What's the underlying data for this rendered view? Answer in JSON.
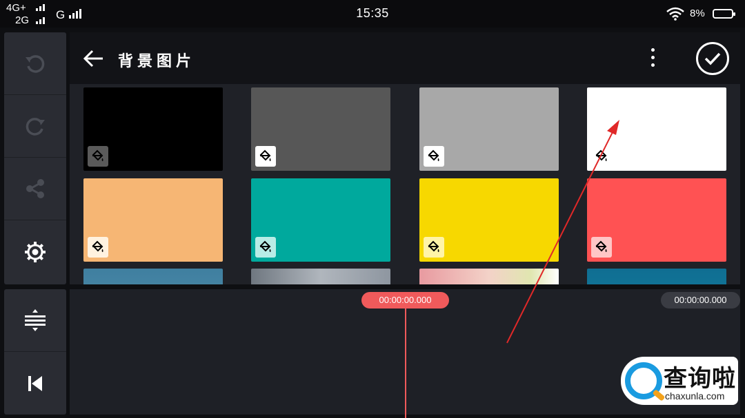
{
  "status_bar": {
    "network_1": "4G+",
    "network_2": "2G",
    "network_3": "G",
    "time": "15:35",
    "battery": "8%"
  },
  "toolbar": {
    "icons": [
      "undo-icon",
      "redo-icon",
      "share-icon",
      "settings-gear-icon"
    ],
    "bottom_icons": [
      "timeline-expand-icon",
      "skip-to-start-icon"
    ]
  },
  "header": {
    "title": "背景图片",
    "back_icon": "arrow-left-icon",
    "more_icon": "more-vertical-icon",
    "confirm_icon": "checkmark-circle-icon"
  },
  "backgrounds": [
    {
      "color": "#000000",
      "type": "solid"
    },
    {
      "color": "#575757",
      "type": "solid"
    },
    {
      "color": "#a8a8a8",
      "type": "solid"
    },
    {
      "color": "#ffffff",
      "type": "solid"
    },
    {
      "color": "#f6b674",
      "type": "solid"
    },
    {
      "color": "#00a99d",
      "type": "solid"
    },
    {
      "color": "#f7d800",
      "type": "solid"
    },
    {
      "color": "#ff5253",
      "type": "solid"
    },
    {
      "color": "#3f7fa0",
      "type": "image"
    },
    {
      "color": "#8e96a0",
      "type": "image"
    },
    {
      "color": "#d9a3a3",
      "type": "image"
    },
    {
      "color": "#147a9c",
      "type": "image"
    }
  ],
  "timeline": {
    "current_time": "00:00:00.000",
    "total_time": "00:00:00.000",
    "accent_color": "#f05a5b"
  },
  "watermark": {
    "text_cn": "查询啦",
    "text_en": "chaxunla.com"
  }
}
